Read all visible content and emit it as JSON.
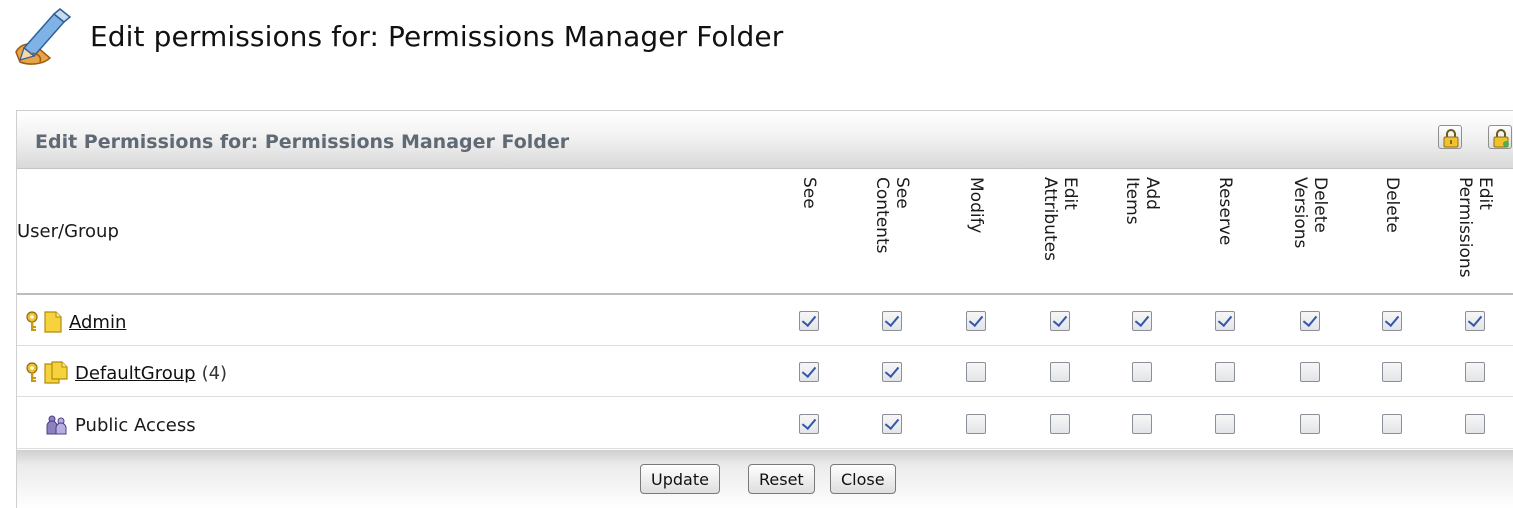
{
  "page": {
    "title": "Edit permissions for: Permissions Manager Folder",
    "icon": "edit-pencil-icon"
  },
  "panel": {
    "title": "Edit Permissions for: Permissions Manager Folder",
    "toolbar_icons": [
      "lock-icon",
      "lock-add-icon"
    ]
  },
  "table": {
    "user_group_header": "User/Group",
    "columns": [
      {
        "label": "See"
      },
      {
        "label": "See\nContents"
      },
      {
        "label": "Modify"
      },
      {
        "label": "Edit\nAttributes"
      },
      {
        "label": "Add\nItems"
      },
      {
        "label": "Reserve"
      },
      {
        "label": "Delete\nVersions"
      },
      {
        "label": "Delete"
      },
      {
        "label": "Edit\nPermissions"
      }
    ],
    "rows": [
      {
        "name": "Admin",
        "count": "",
        "link": true,
        "icon": "user-icon",
        "owner_icon": "key-icon",
        "permissions": [
          true,
          true,
          true,
          true,
          true,
          true,
          true,
          true,
          true
        ]
      },
      {
        "name": "DefaultGroup",
        "count": "(4)",
        "link": true,
        "icon": "group-icon",
        "owner_icon": "key-icon",
        "permissions": [
          true,
          true,
          false,
          false,
          false,
          false,
          false,
          false,
          false
        ]
      },
      {
        "name": "Public Access",
        "count": "",
        "link": false,
        "icon": "public-access-icon",
        "owner_icon": "",
        "permissions": [
          true,
          true,
          false,
          false,
          false,
          false,
          false,
          false,
          false
        ]
      }
    ]
  },
  "footer": {
    "update_label": "Update",
    "reset_label": "Reset",
    "close_label": "Close"
  },
  "colors": {
    "panel_title": "#5f6a74",
    "checkmark": "#3457a8",
    "icon_yellow": "#f2c22e"
  }
}
